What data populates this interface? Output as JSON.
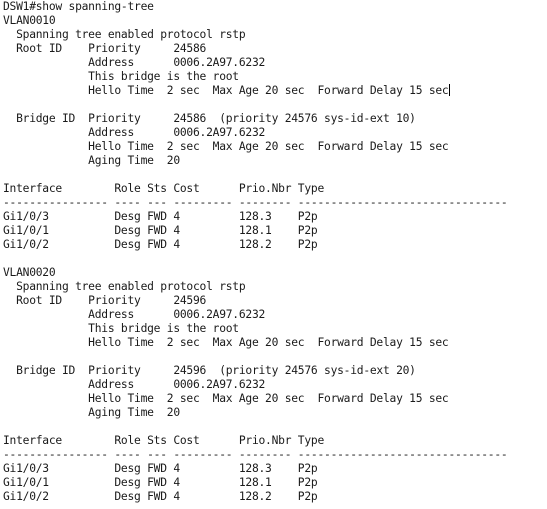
{
  "terminal": {
    "lines": [
      "DSW1#show spanning-tree",
      "VLAN0010",
      "  Spanning tree enabled protocol rstp",
      "  Root ID    Priority     24586",
      "             Address      0006.2A97.6232",
      "             This bridge is the root",
      "             Hello Time  2 sec  Max Age 20 sec  Forward Delay 15 sec",
      "",
      "  Bridge ID  Priority     24586  (priority 24576 sys-id-ext 10)",
      "             Address      0006.2A97.6232",
      "             Hello Time  2 sec  Max Age 20 sec  Forward Delay 15 sec",
      "             Aging Time  20",
      "",
      "Interface        Role Sts Cost      Prio.Nbr Type",
      "---------------- ---- --- --------- -------- --------------------------------",
      "Gi1/0/3          Desg FWD 4         128.3    P2p",
      "Gi1/0/1          Desg FWD 4         128.1    P2p",
      "Gi1/0/2          Desg FWD 4         128.2    P2p",
      "",
      "VLAN0020",
      "  Spanning tree enabled protocol rstp",
      "  Root ID    Priority     24596",
      "             Address      0006.2A97.6232",
      "             This bridge is the root",
      "             Hello Time  2 sec  Max Age 20 sec  Forward Delay 15 sec",
      "",
      "  Bridge ID  Priority     24596  (priority 24576 sys-id-ext 20)",
      "             Address      0006.2A97.6232",
      "             Hello Time  2 sec  Max Age 20 sec  Forward Delay 15 sec",
      "             Aging Time  20",
      "",
      "Interface        Role Sts Cost      Prio.Nbr Type",
      "---------------- ---- --- --------- -------- --------------------------------",
      "Gi1/0/3          Desg FWD 4         128.3    P2p",
      "Gi1/0/1          Desg FWD 4         128.1    P2p",
      "Gi1/0/2          Desg FWD 4         128.2    P2p"
    ],
    "cursor_line": 6
  }
}
